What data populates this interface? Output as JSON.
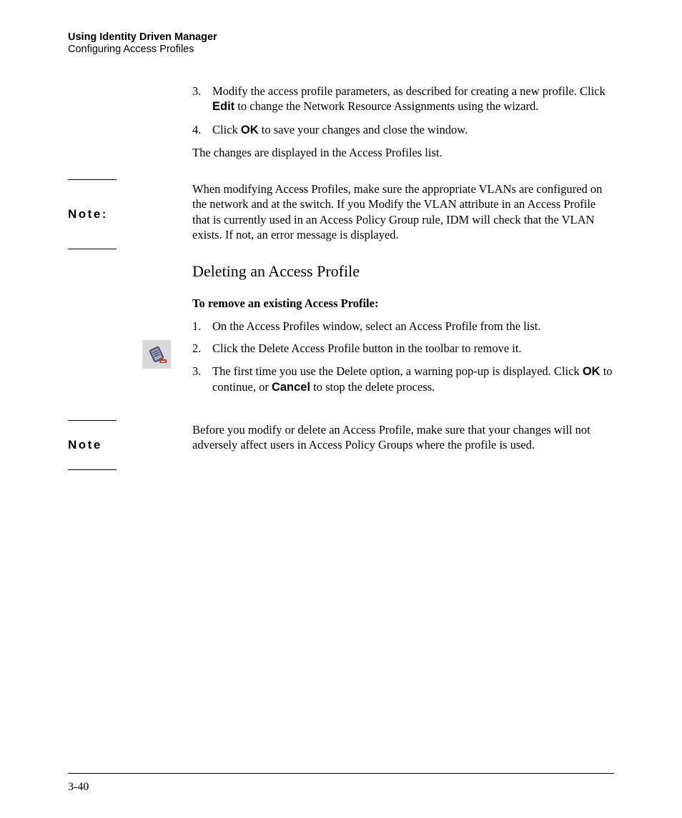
{
  "header": {
    "chapter": "Using Identity Driven Manager",
    "section": "Configuring Access Profiles"
  },
  "top_list": {
    "item3": {
      "num": "3.",
      "pre": "Modify the access profile parameters, as described for creating a new profile. Click ",
      "bold": "Edit",
      "post": " to change the Network Resource Assignments using the wizard."
    },
    "item4": {
      "num": "4.",
      "pre": "Click ",
      "bold": "OK",
      "post": " to save your changes and close the window."
    }
  },
  "result_para": "The changes are displayed in the Access Profiles list.",
  "note1": {
    "label": "Note:",
    "body": "When modifying Access Profiles, make sure the appropriate VLANs are configured on the network and at the switch. If you Modify the VLAN attribute in an Access Profile that is currently used in an Access Policy Group rule, IDM will check that the VLAN exists. If not, an error message is displayed."
  },
  "section_title": "Deleting an Access Profile",
  "lead": "To remove an existing Access Profile:",
  "del_list": {
    "item1": {
      "num": "1.",
      "text": "On the Access Profiles window, select an Access Profile from the list."
    },
    "item2": {
      "num": "2.",
      "text": "Click the Delete Access Profile button in the toolbar to remove it."
    },
    "item3": {
      "num": "3.",
      "pre": "The first time you use the Delete option, a warning pop-up is displayed. Click ",
      "bold1": "OK",
      "mid": " to continue, or ",
      "bold2": "Cancel",
      "post": " to stop the delete process."
    }
  },
  "note2": {
    "label": "Note",
    "body": "Before you modify or delete an Access Profile, make sure that your changes will not adversely affect users in Access Policy Groups where the profile is used."
  },
  "page_number": "3-40"
}
